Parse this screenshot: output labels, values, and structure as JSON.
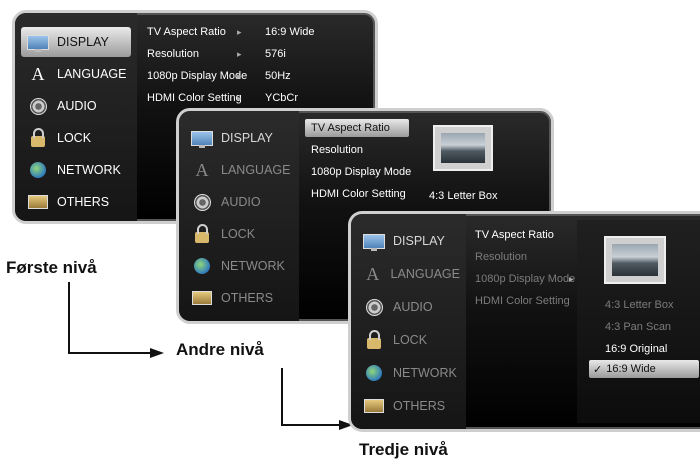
{
  "menu": {
    "display": "DISPLAY",
    "language": "LANGUAGE",
    "audio": "AUDIO",
    "lock": "LOCK",
    "network": "NETWORK",
    "others": "OTHERS"
  },
  "settings": {
    "aspect_ratio": "TV Aspect Ratio",
    "resolution": "Resolution",
    "display_mode": "1080p Display Mode",
    "color_setting": "HDMI Color Setting"
  },
  "values": {
    "aspect_ratio": "16:9 Wide",
    "resolution": "576i",
    "display_mode": "50Hz",
    "color_setting": "YCbCr"
  },
  "options": {
    "letter_box": "4:3 Letter Box",
    "pan_scan": "4:3 Pan Scan",
    "original": "16:9 Original",
    "wide": "16:9 Wide",
    "checkmark": "✓"
  },
  "labels": {
    "level1": "Første nivå",
    "level2": "Andre nivå",
    "level3": "Tredje nivå"
  },
  "icons": [
    "monitor-icon",
    "letter-a-icon",
    "speaker-icon",
    "lock-icon",
    "globe-icon",
    "box-icon",
    "chevron-right-icon",
    "checkmark-icon"
  ]
}
